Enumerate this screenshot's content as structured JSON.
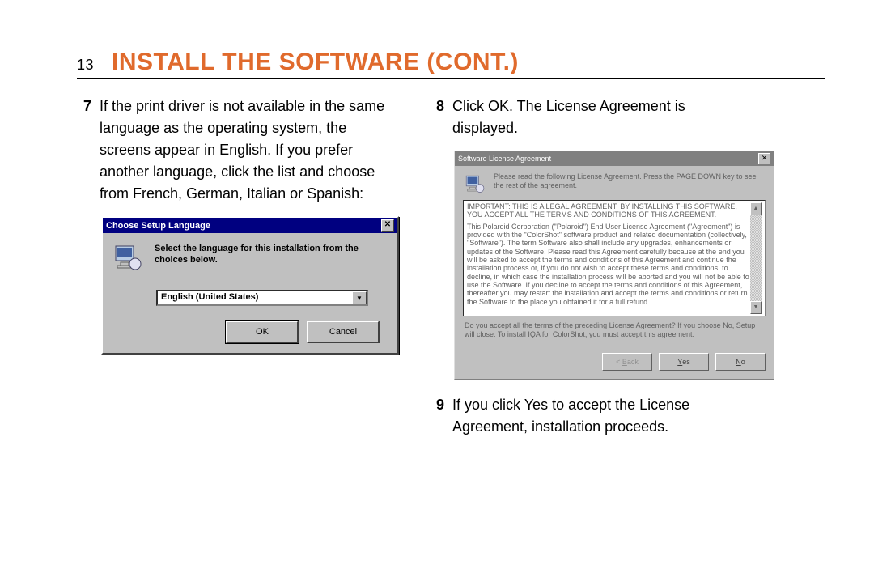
{
  "page_number": "13",
  "title": "INSTALL THE SOFTWARE (CONT.)",
  "steps": {
    "s7": {
      "num": "7",
      "text": "If the print driver is not available in the same language as the operating system, the screens appear in English. If you prefer another language, click the list and choose from French, German, Italian or Spanish:"
    },
    "s8": {
      "num": "8",
      "text": "Click OK. The License Agreement is displayed."
    },
    "s9": {
      "num": "9",
      "text": "If you click Yes to accept the License Agreement, installation proceeds."
    }
  },
  "dialog1": {
    "title": "Choose Setup Language",
    "message": "Select the language for this installation from the choices below.",
    "selected": "English (United States)",
    "ok": "OK",
    "cancel": "Cancel"
  },
  "dialog2": {
    "title": "Software License Agreement",
    "instruction": "Please read the following License Agreement. Press the PAGE DOWN key to see the rest of the agreement.",
    "heading": "IMPORTANT: THIS IS A LEGAL AGREEMENT. BY INSTALLING THIS SOFTWARE, YOU ACCEPT ALL THE TERMS AND CONDITIONS OF THIS AGREEMENT.",
    "body": "This Polaroid Corporation (\"Polaroid\") End User License Agreement (\"Agreement\") is provided with the \"ColorShot\" software product and related documentation (collectively, \"Software\"). The term Software also shall include any upgrades, enhancements or updates of the Software. Please read this Agreement carefully because at the end you will be asked to accept the terms and conditions of this Agreement and continue the installation process or, if you do not wish to accept these terms and conditions, to decline, in which case the installation process will be aborted and you will not be able to use the Software. If you decline to accept the terms and conditions of this Agreement, thereafter you may restart the installation and accept the terms and conditions or return the Software to the place you obtained it for a full refund.",
    "question": "Do you accept all the terms of the preceding License Agreement? If you choose No, Setup will close. To install IQA for ColorShot, you must accept this agreement.",
    "back": "< Back",
    "yes": "Yes",
    "no": "No"
  }
}
